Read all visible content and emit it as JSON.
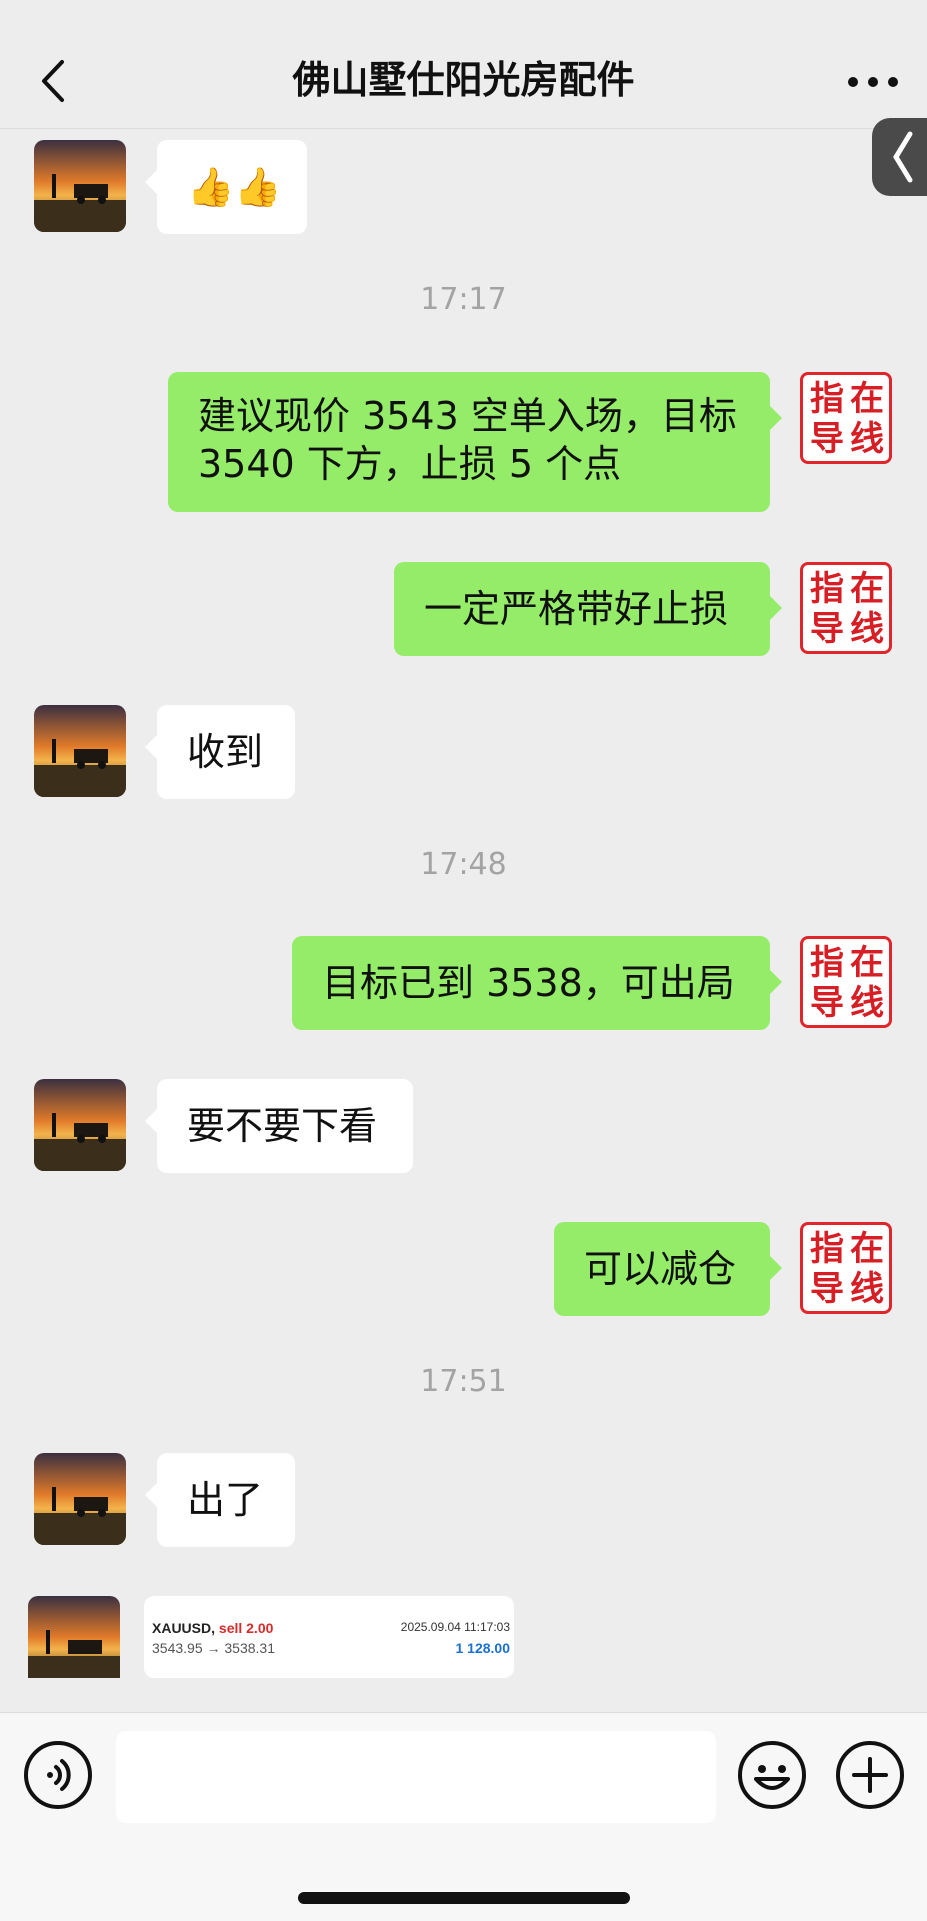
{
  "header": {
    "title": "佛山墅仕阳光房配件"
  },
  "messages": {
    "m1": "👍👍",
    "t1": "17:17",
    "m2": "建议现价 3543 空单入场，目标 3540 下方，止损 5 个点",
    "m3": "一定严格带好止损",
    "m4": "收到",
    "t2": "17:48",
    "m5": "目标已到 3538，可出局",
    "m6": "要不要下看",
    "m7": "可以减仓",
    "t3": "17:51",
    "m8": "出了"
  },
  "seal": {
    "c1": "指",
    "c2": "在",
    "c3": "导",
    "c4": "线"
  },
  "trade_card": {
    "symbol": "XAUUSD,",
    "side": "sell 2.00",
    "datetime": "2025.09.04 11:17:03",
    "price_change": "3543.95 → 3538.31",
    "profit": "1 128.00"
  },
  "colors": {
    "outgoing_bubble": "#95ec69",
    "incoming_bubble": "#ffffff",
    "seal_red": "#d61e24",
    "background": "#ededed"
  },
  "icons": [
    "back-icon",
    "more-icon",
    "side-tab-icon",
    "voice-icon",
    "emoji-icon",
    "plus-icon"
  ]
}
